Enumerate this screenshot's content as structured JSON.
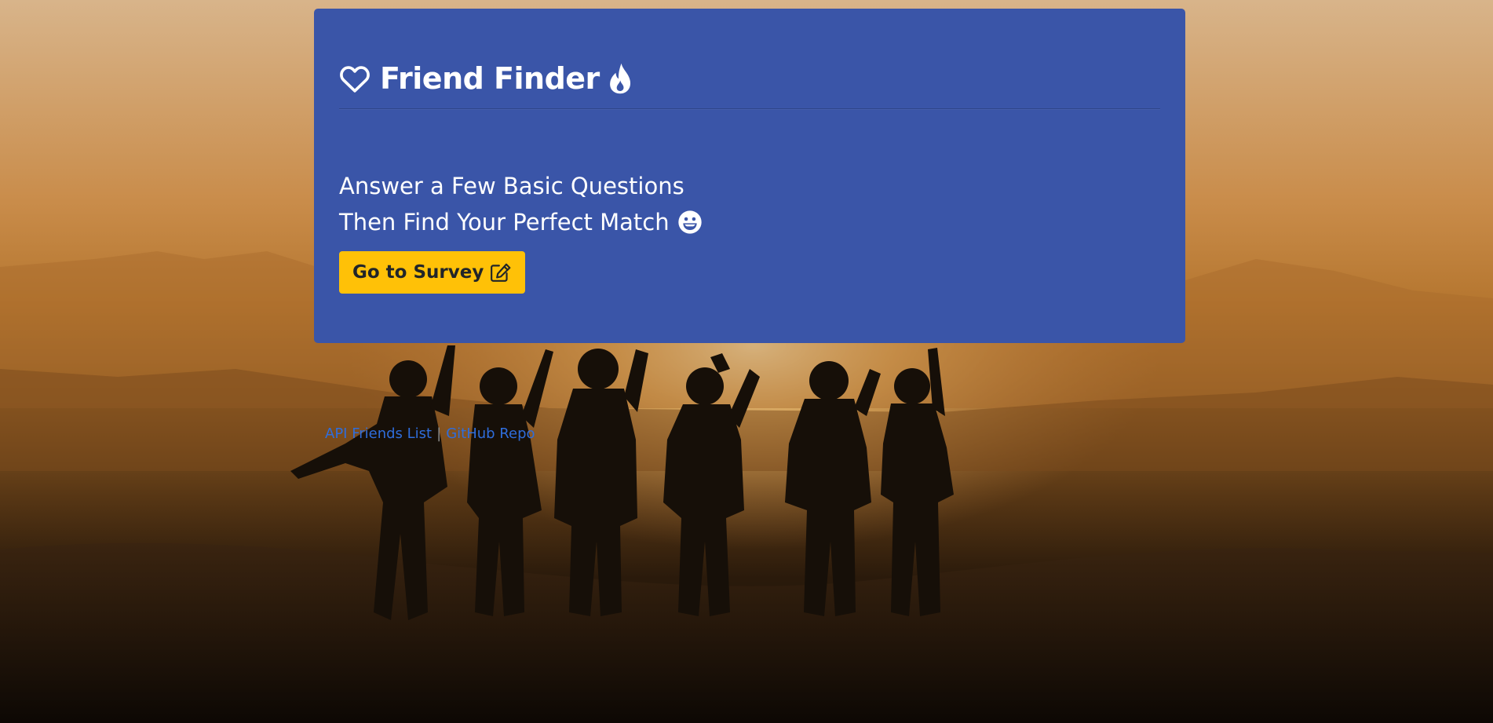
{
  "header": {
    "title": "Friend Finder",
    "title_icon_left": "heart-outline-icon",
    "title_icon_right": "fire-icon"
  },
  "lead": {
    "line1": "Answer a Few Basic Questions",
    "line2": "Then Find Your Perfect Match",
    "line2_icon": "grinning-face-icon"
  },
  "survey_button": {
    "label": "Go to Survey",
    "icon": "edit-icon"
  },
  "footer": {
    "api_link": "API Friends List",
    "separator": "|",
    "github_link": "GitHub Repo"
  },
  "colors": {
    "jumbotron": "#3a55a8",
    "button": "#ffc107",
    "link": "#2f6ddb"
  }
}
